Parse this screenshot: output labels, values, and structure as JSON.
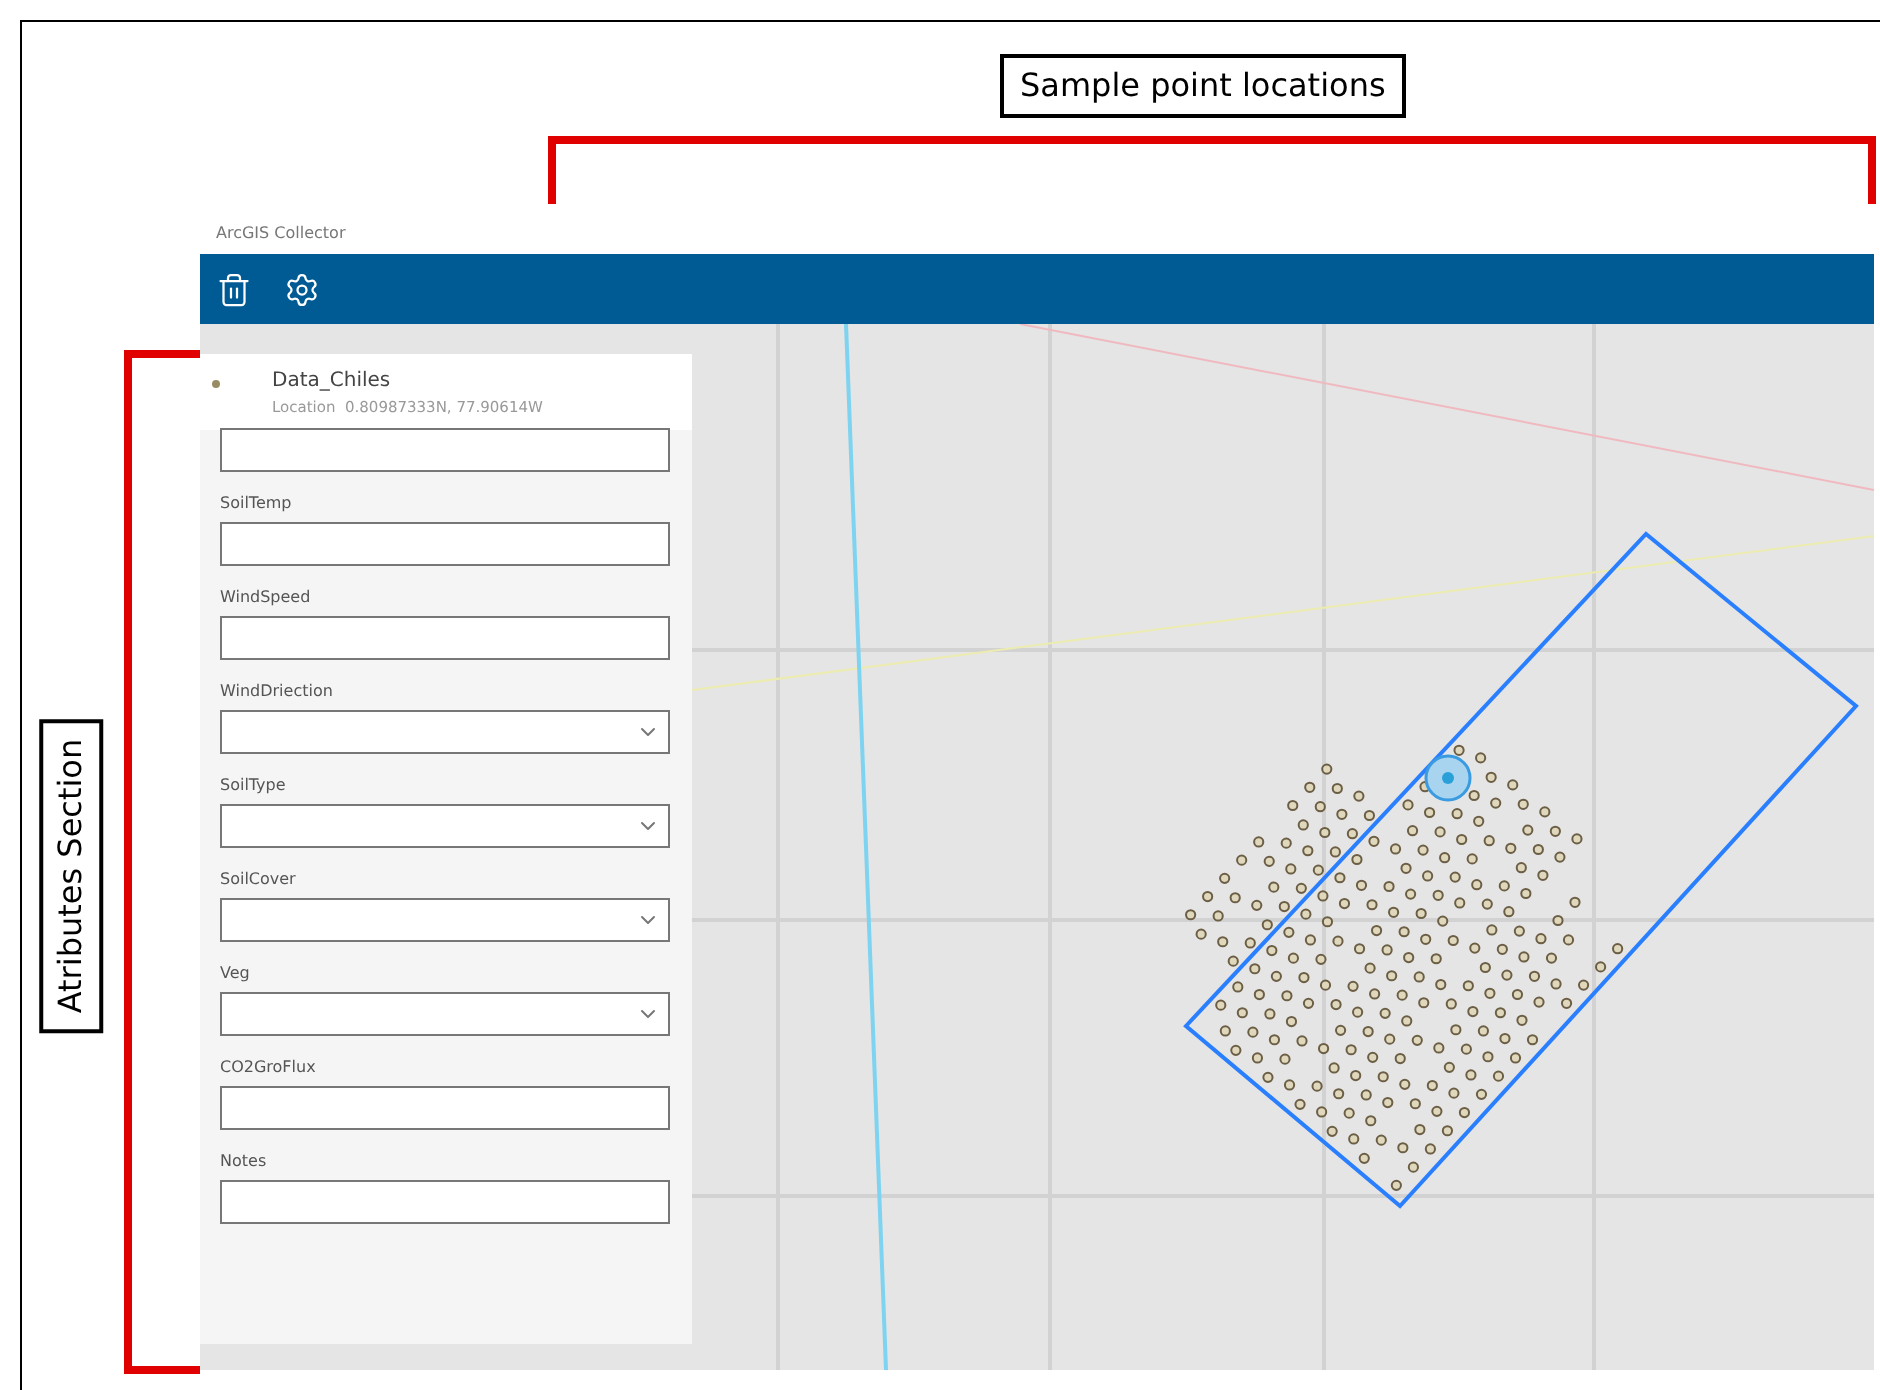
{
  "annotations": {
    "top_label": "Sample point locations",
    "side_label": "Atributes Section"
  },
  "app": {
    "title": "ArcGIS Collector"
  },
  "feature": {
    "name": "Data_Chiles",
    "location": "Location  0.80987333N, 77.90614W"
  },
  "fields": [
    {
      "kind": "text"
    },
    {
      "kind": "text",
      "label": "SoilTemp"
    },
    {
      "kind": "text",
      "label": "WindSpeed"
    },
    {
      "kind": "dropdown",
      "label": "WindDriection"
    },
    {
      "kind": "dropdown",
      "label": "SoilType"
    },
    {
      "kind": "dropdown",
      "label": "SoilCover"
    },
    {
      "kind": "dropdown",
      "label": "Veg"
    },
    {
      "kind": "text",
      "label": "CO2GroFlux"
    },
    {
      "kind": "text",
      "label": "Notes"
    }
  ]
}
